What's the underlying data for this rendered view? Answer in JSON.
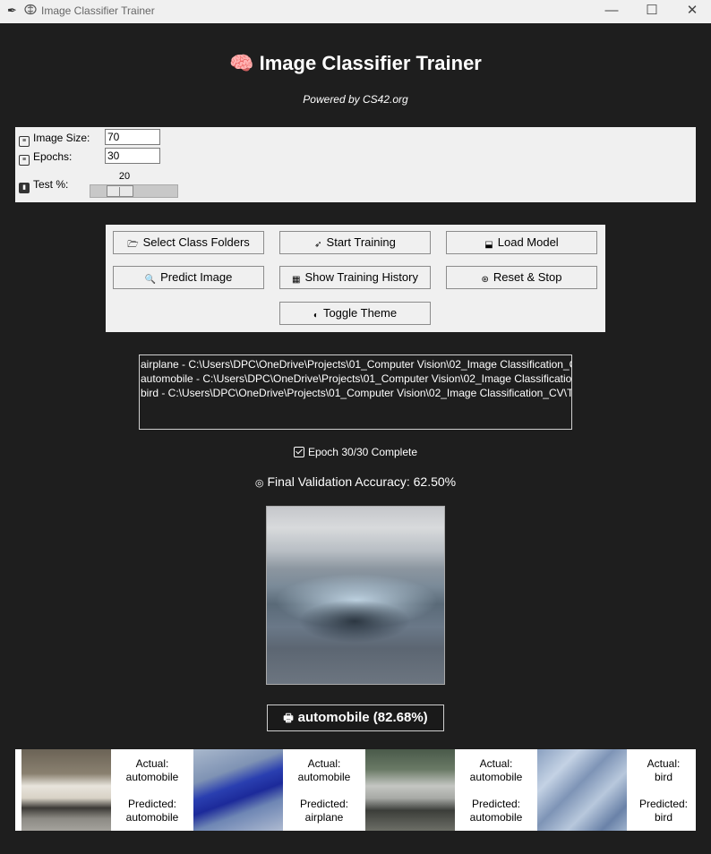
{
  "window": {
    "title": "Image Classifier Trainer",
    "controls": [
      "—",
      "☐",
      "✕"
    ]
  },
  "header": {
    "title": "🧠 Image Classifier Trainer",
    "subtitle": "Powered by CS42.org"
  },
  "settings": {
    "image_size_label": "Image Size:",
    "image_size_value": "70",
    "epochs_label": "Epochs:",
    "epochs_value": "30",
    "test_label": "Test %:",
    "test_value": "20"
  },
  "buttons": {
    "select_folders": "Select Class Folders",
    "start_training": "Start Training",
    "load_model": "Load Model",
    "predict_image": "Predict Image",
    "show_history": "Show Training History",
    "reset_stop": "Reset & Stop",
    "toggle_theme": "Toggle Theme"
  },
  "class_list": [
    "airplane - C:\\Users\\DPC\\OneDrive\\Projects\\01_Computer Vision\\02_Image Classification_CV",
    "automobile - C:\\Users\\DPC\\OneDrive\\Projects\\01_Computer Vision\\02_Image Classification",
    "bird - C:\\Users\\DPC\\OneDrive\\Projects\\01_Computer Vision\\02_Image Classification_CV\\Te"
  ],
  "status": {
    "epoch_text": "Epoch 30/30 Complete",
    "accuracy_text": "Final Validation Accuracy: 62.50%"
  },
  "prediction": {
    "text": "automobile (82.68%)"
  },
  "samples": [
    {
      "actual_label": "Actual:",
      "actual": "automobile",
      "predicted_label": "Predicted:",
      "predicted": "automobile"
    },
    {
      "actual_label": "Actual:",
      "actual": "automobile",
      "predicted_label": "Predicted:",
      "predicted": "airplane"
    },
    {
      "actual_label": "Actual:",
      "actual": "automobile",
      "predicted_label": "Predicted:",
      "predicted": "automobile"
    },
    {
      "actual_label": "Actual:",
      "actual": "bird",
      "predicted_label": "Predicted:",
      "predicted": "bird"
    }
  ],
  "colors": {
    "background": "#1e1e1e",
    "panel": "#f0f0f0",
    "text_light": "#ffffff"
  }
}
